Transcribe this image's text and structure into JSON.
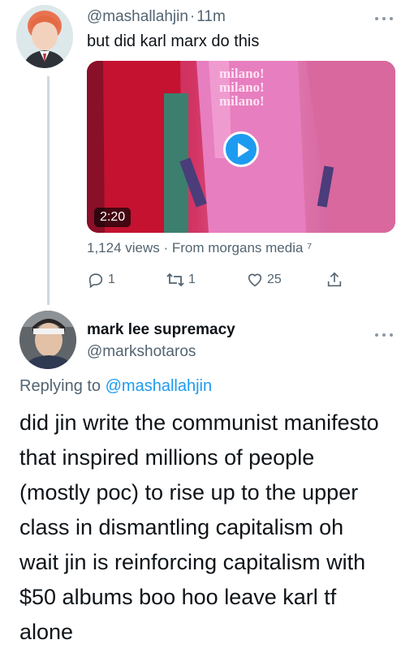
{
  "tweet1": {
    "handle": "@mashallahjin",
    "separator": "·",
    "time": "11m",
    "text": "but did karl marx do this",
    "video_shirt_text": [
      "milano!",
      "milano!",
      "milano!"
    ],
    "video_duration": "2:20",
    "views_line": "1,124 views · From morgans media ⁷",
    "reply_count": "1",
    "retweet_count": "1",
    "like_count": "25"
  },
  "tweet2": {
    "name": "mark lee supremacy",
    "handle": "@markshotaros",
    "replying_prefix": "Replying to",
    "replying_mention": "@mashallahjin",
    "body_lines": [
      "did jin write the communist manifesto",
      "that inspired millions of people",
      "(mostly poc) to rise up to the upper",
      "class in dismantling capitalism oh",
      "wait jin is reinforcing capitalism with",
      "$50 albums boo hoo leave karl tf",
      "alone"
    ]
  },
  "icons": {
    "more": "more-horizontal-icon",
    "reply": "reply-icon",
    "retweet": "retweet-icon",
    "like": "heart-icon",
    "share": "share-icon",
    "play": "play-icon"
  },
  "colors": {
    "accent": "#1d9bf0",
    "secondary_text": "#536471",
    "primary_text": "#0f1419",
    "thread_line": "#cfd9de"
  }
}
